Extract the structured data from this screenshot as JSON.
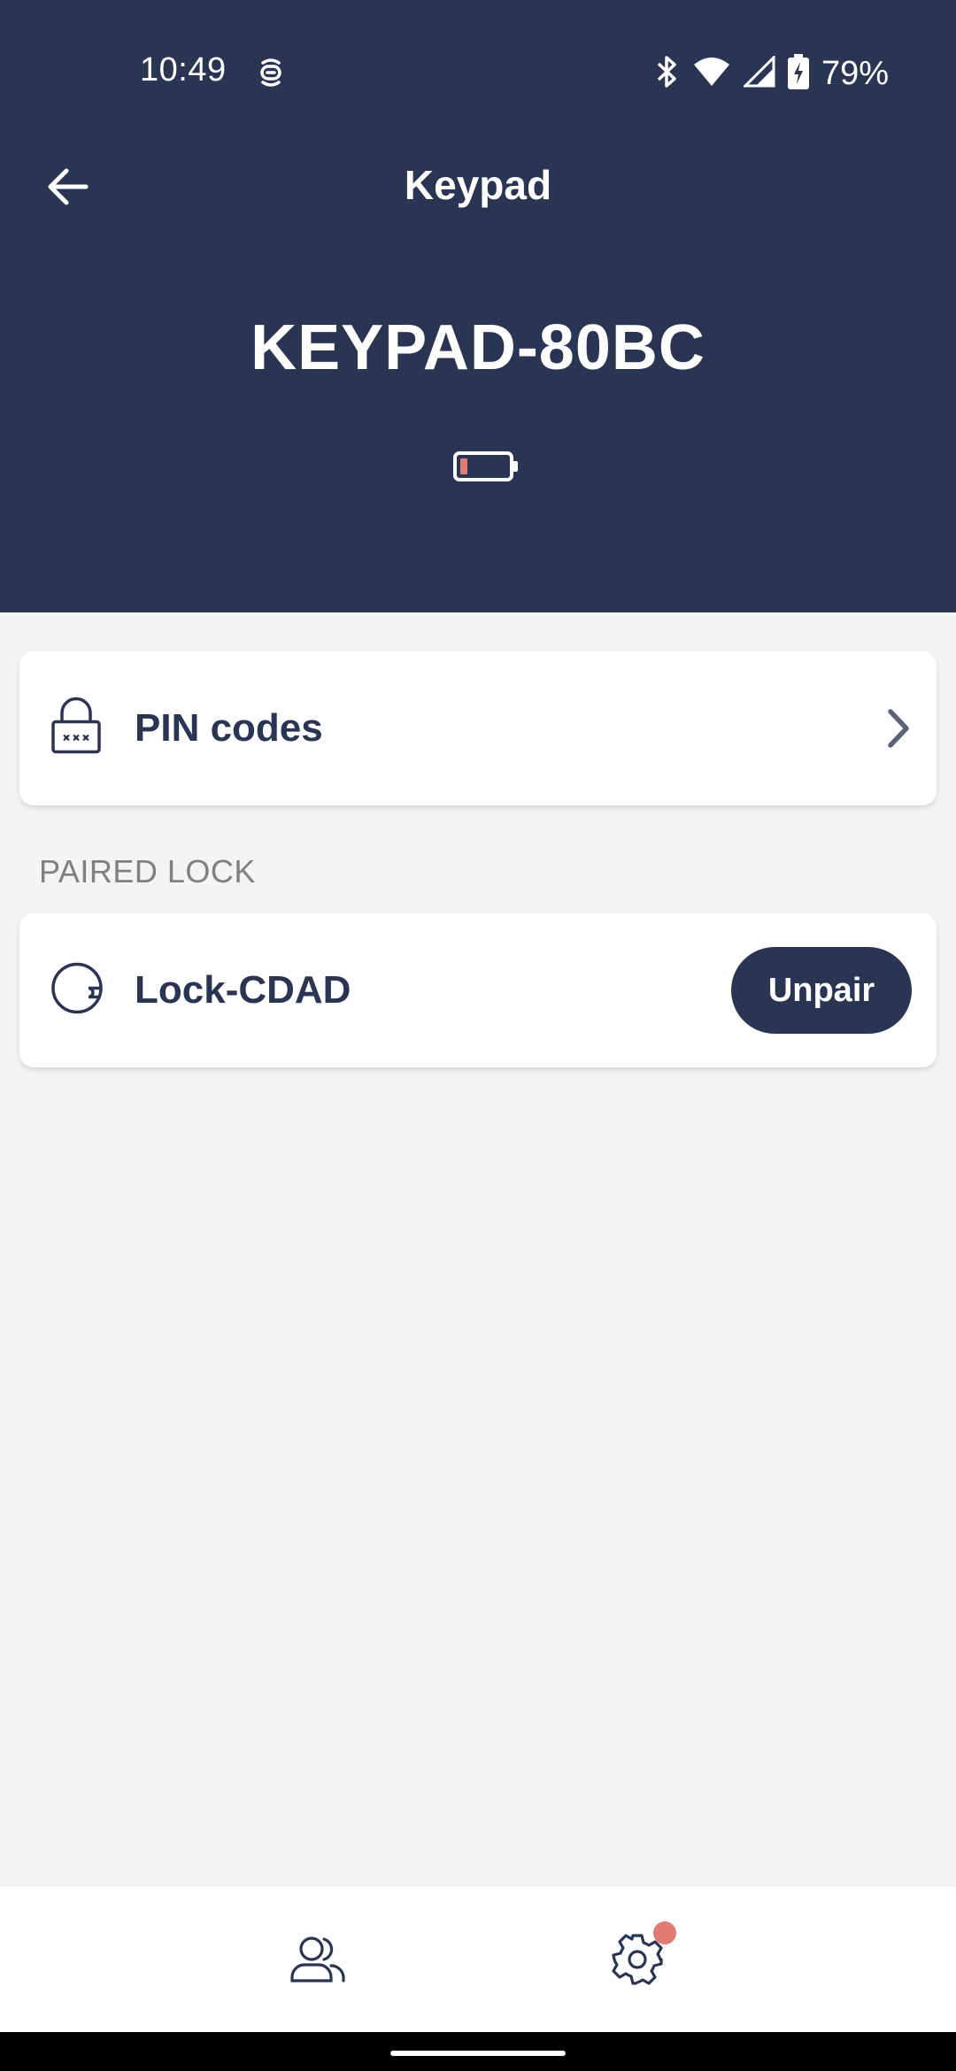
{
  "status_bar": {
    "time": "10:49",
    "battery_percent": "79%",
    "icons": [
      "bluetooth-icon",
      "wifi-icon",
      "cellular-signal-icon",
      "battery-charging-icon"
    ]
  },
  "appbar": {
    "title": "Keypad",
    "back_icon": "arrow-left-icon"
  },
  "device": {
    "name": "KEYPAD-80BC",
    "battery_level": 0.15,
    "battery_color": "#e07a74"
  },
  "pin_codes": {
    "label": "PIN codes",
    "icon": "padlock-pin-icon"
  },
  "paired_lock": {
    "section_label": "PAIRED LOCK",
    "lock_name": "Lock-CDAD",
    "unpair_label": "Unpair",
    "icon": "lock-dial-icon"
  },
  "bottom_nav": {
    "items": [
      "users-icon",
      "settings-gear-icon"
    ],
    "settings_has_notification": true
  },
  "colors": {
    "primary": "#2a3453",
    "background": "#f4f4f4",
    "accent_red": "#e07a74"
  }
}
